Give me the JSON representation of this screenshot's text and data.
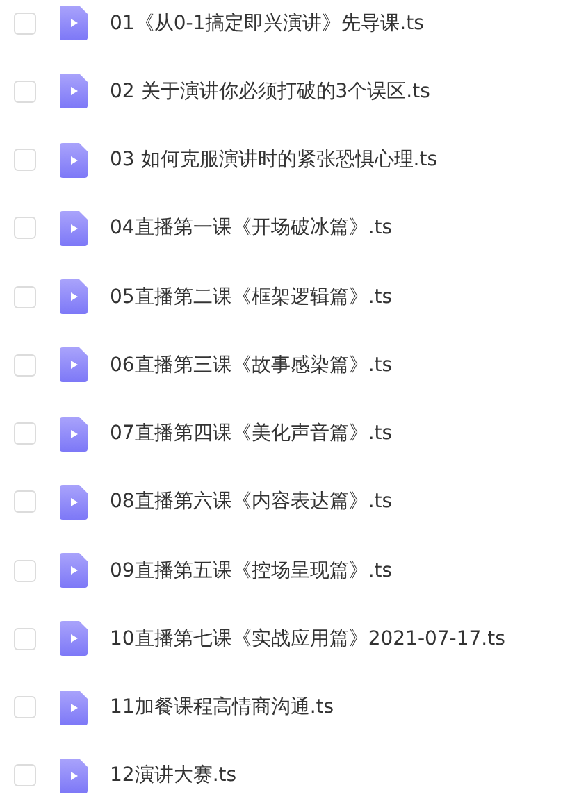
{
  "files": [
    {
      "name": "01《从0-1搞定即兴演讲》先导课.ts",
      "checked": false
    },
    {
      "name": "02 关于演讲你必须打破的3个误区.ts",
      "checked": false
    },
    {
      "name": "03 如何克服演讲时的紧张恐惧心理.ts",
      "checked": false
    },
    {
      "name": "04直播第一课《开场破冰篇》.ts",
      "checked": false
    },
    {
      "name": "05直播第二课《框架逻辑篇》.ts",
      "checked": false
    },
    {
      "name": "06直播第三课《故事感染篇》.ts",
      "checked": false
    },
    {
      "name": "07直播第四课《美化声音篇》.ts",
      "checked": false
    },
    {
      "name": "08直播第六课《内容表达篇》.ts",
      "checked": false
    },
    {
      "name": "09直播第五课《控场呈现篇》.ts",
      "checked": false
    },
    {
      "name": "10直播第七课《实战应用篇》2021-07-17.ts",
      "checked": false
    },
    {
      "name": "11加餐课程高情商沟通.ts",
      "checked": false
    },
    {
      "name": "12演讲大赛.ts",
      "checked": false
    }
  ]
}
